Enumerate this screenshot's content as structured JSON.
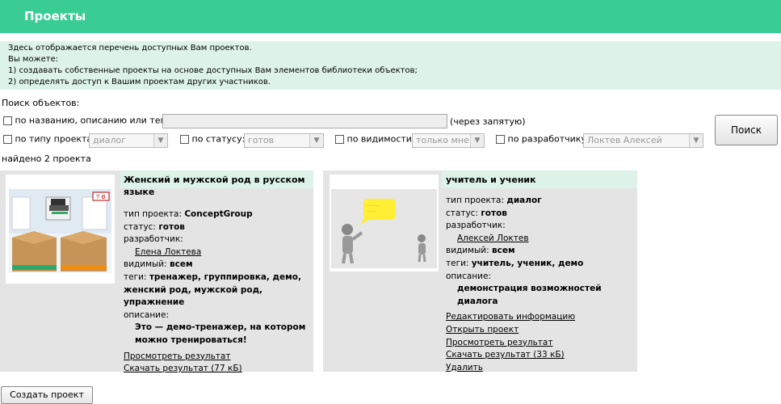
{
  "header": {
    "title": "Проекты"
  },
  "info": {
    "lines": [
      "Здесь отображается перечень доступных Вам проектов.",
      "Вы можете:",
      "1) создавать собственные проекты на основе доступных Вам элементов библиотеки объектов;",
      "2) определять доступ к Вашим проектам других участников."
    ]
  },
  "search": {
    "label": "Поиск объектов:",
    "by_name_label": "по названию, описанию или тегам:",
    "by_name_value": "",
    "comma_hint": "(через запятую)",
    "by_type_label": "по типу проекта:",
    "type_value": "диалог",
    "by_status_label": "по статусу:",
    "status_value": "готов",
    "by_visibility_label": "по видимости:",
    "visibility_value": "только мне",
    "by_developer_label": "по разработчику:",
    "developer_value": "Локтев Алексей",
    "button": "Поиск"
  },
  "found_text": "найдено 2 проекта",
  "colors": {
    "header": "#39cc94",
    "info_bg": "#ddf3e9",
    "card_bg": "#e4e4e4"
  },
  "projects": [
    {
      "title": "Женский и мужской род в русском языке",
      "type_label": "тип проекта:",
      "type": "ConceptGroup",
      "status_label": "статус:",
      "status": "готов",
      "developer_label": "разработчик:",
      "developer": "Елена Локтева",
      "visible_label": "видимый:",
      "visible": "всем",
      "tags_label": "теги:",
      "tags": "тренажер, группировка, демо, женский род, мужской род, упражнение",
      "desc_label": "описание:",
      "description": "Это — демо-тренажер, на котором можно тренироваться!",
      "actions": [
        "Просмотреть результат",
        "Скачать результат (77 кБ)"
      ]
    },
    {
      "title": "учитель и ученик",
      "type_label": "тип проекта:",
      "type": "диалог",
      "status_label": "статус:",
      "status": "готов",
      "developer_label": "разработчик:",
      "developer": "Алексей Локтев",
      "visible_label": "видимый:",
      "visible": "всем",
      "tags_label": "теги:",
      "tags": "учитель, ученик, демо",
      "desc_label": "описание:",
      "description": "демонстрация возможностей диалога",
      "actions": [
        "Редактировать информацию",
        "Открыть проект",
        "Просмотреть результат",
        "Скачать результат (33 кБ)",
        "Удалить"
      ]
    }
  ],
  "create_button": "Создать проект"
}
